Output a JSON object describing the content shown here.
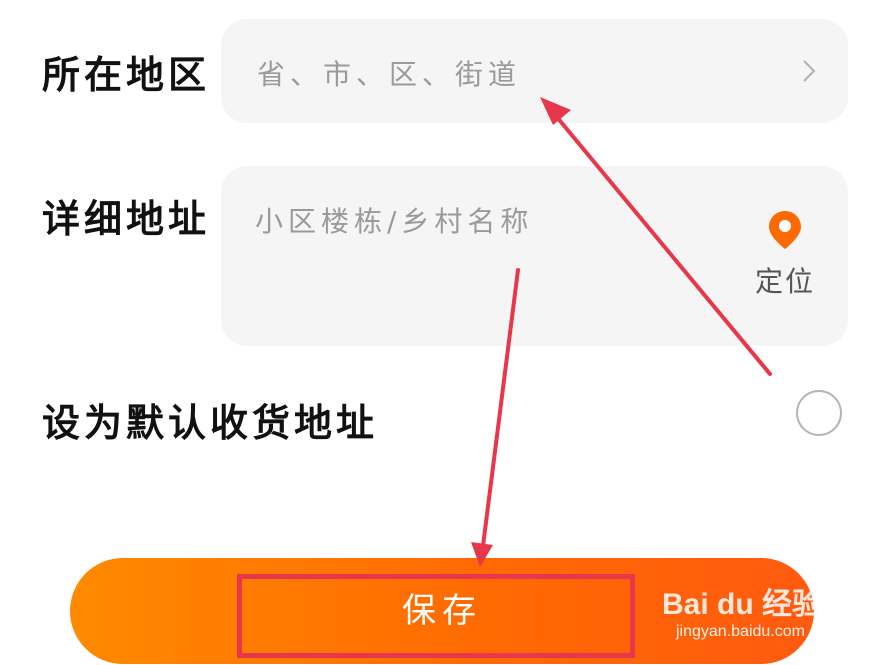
{
  "form": {
    "region_label": "所在地区",
    "region_placeholder": "省、市、区、街道",
    "detail_label": "详细地址",
    "detail_placeholder": "小区楼栋/乡村名称",
    "locate_label": "定位",
    "default_label": "设为默认收货地址",
    "default_checked": false
  },
  "actions": {
    "save_label": "保存"
  },
  "watermark": {
    "brand": "Bai du 经验",
    "url": "jingyan.baidu.com"
  },
  "colors": {
    "accent": "#ff6a00",
    "annotation": "#e8374a",
    "field_bg": "#f5f5f5"
  },
  "icons": {
    "chevron": "chevron-right-icon",
    "locate": "location-pin-icon",
    "radio": "radio-unchecked-icon"
  }
}
